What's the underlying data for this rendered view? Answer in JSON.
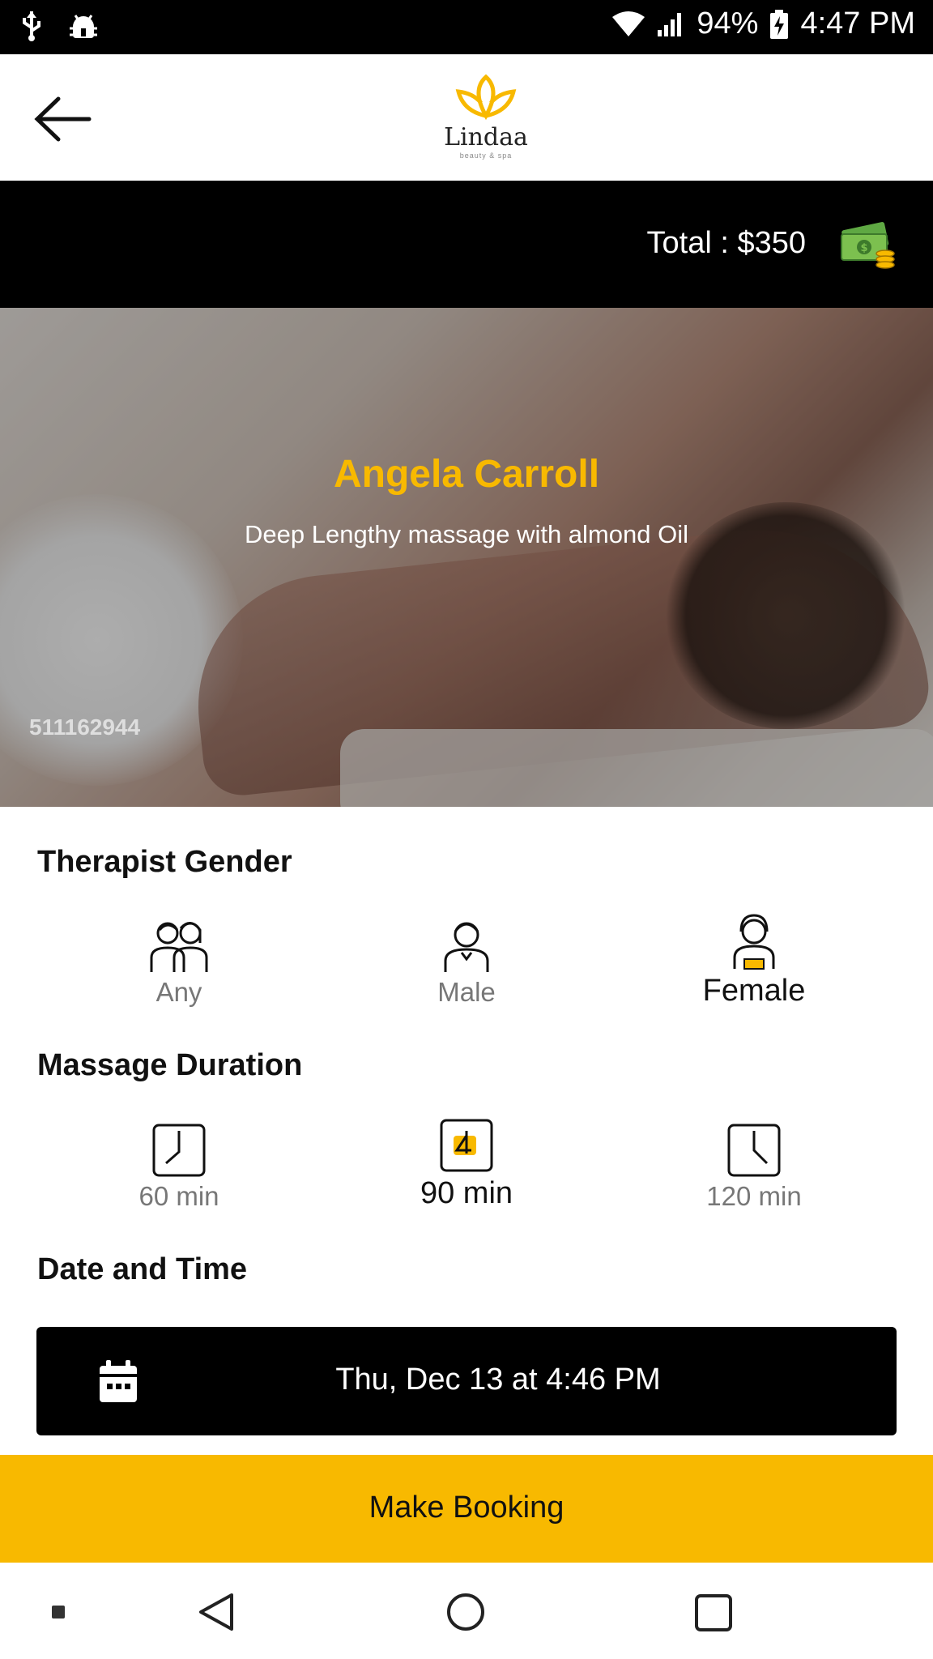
{
  "status": {
    "battery": "94%",
    "time": "4:47 PM"
  },
  "header": {
    "brand": "Lindaa",
    "tagline": "beauty & spa"
  },
  "total": {
    "label": "Total : $350"
  },
  "hero": {
    "name": "Angela Carroll",
    "description": "Deep Lengthy massage with almond Oil",
    "image_id": "511162944"
  },
  "gender": {
    "title": "Therapist Gender",
    "options": [
      {
        "label": "Any",
        "icon": "couple-icon"
      },
      {
        "label": "Male",
        "icon": "male-therapist-icon"
      },
      {
        "label": "Female",
        "icon": "female-therapist-icon"
      }
    ],
    "selected": "Female"
  },
  "duration": {
    "title": "Massage Duration",
    "options": [
      {
        "label": "60 min",
        "icon": "clock-icon"
      },
      {
        "label": "90 min",
        "icon": "clock-icon"
      },
      {
        "label": "120 min",
        "icon": "clock-icon"
      }
    ],
    "selected": "90 min"
  },
  "datetime": {
    "title": "Date and Time",
    "value": "Thu, Dec 13 at 4:46 PM"
  },
  "booking": {
    "button_label": "Make Booking"
  },
  "colors": {
    "accent": "#f8b900",
    "dark": "#000000",
    "muted": "#777777"
  }
}
